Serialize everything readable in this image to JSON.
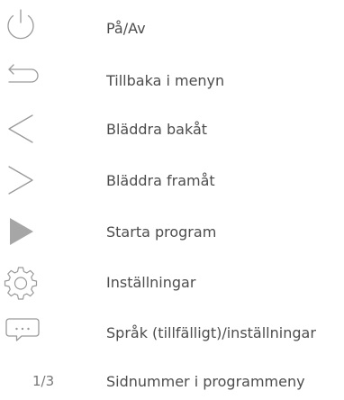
{
  "legend": {
    "items": [
      {
        "icon": "power-icon",
        "label": "På/Av"
      },
      {
        "icon": "back-arrow-icon",
        "label": "Tillbaka i menyn"
      },
      {
        "icon": "chevron-left-icon",
        "label": "Bläddra bakåt"
      },
      {
        "icon": "chevron-right-icon",
        "label": "Bläddra framåt"
      },
      {
        "icon": "play-icon",
        "label": "Starta program"
      },
      {
        "icon": "gear-icon",
        "label": "Inställningar"
      },
      {
        "icon": "speech-bubble-icon",
        "label": "Språk (tillfälligt)/inställningar"
      },
      {
        "icon": "page-number-text",
        "page_text": "1/3",
        "label": "Sidnummer i programmeny"
      }
    ]
  },
  "colors": {
    "icon_stroke": "#8a8a8a",
    "icon_fill": "#a6a6a6",
    "label_text": "#4d4d4d"
  }
}
